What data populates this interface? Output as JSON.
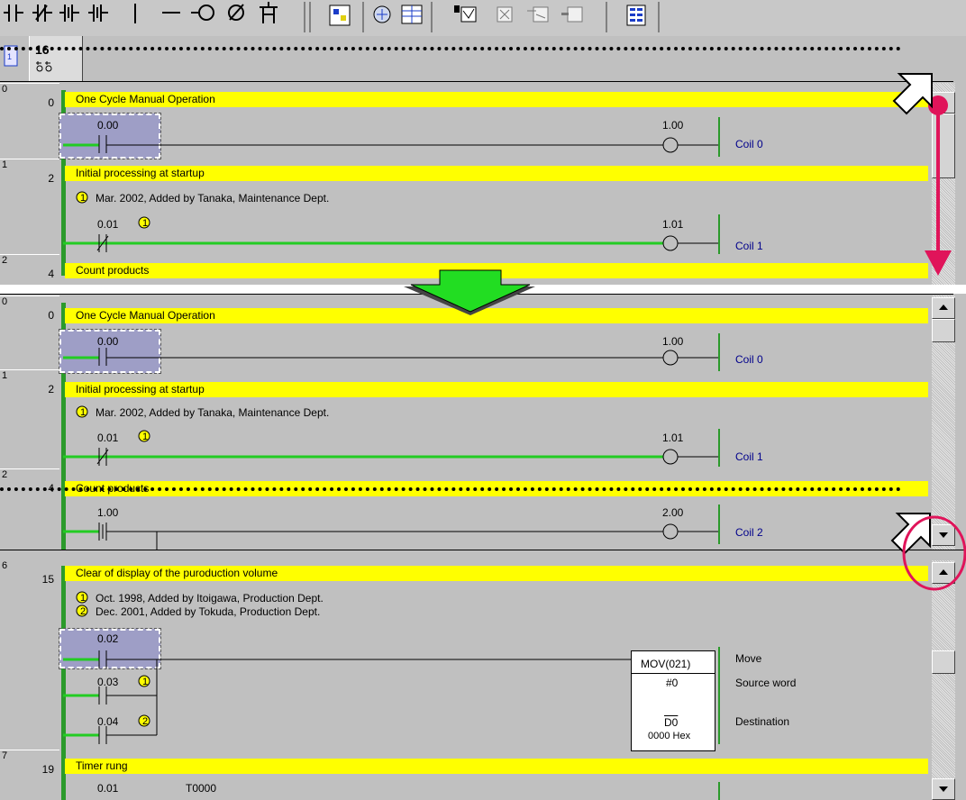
{
  "toolbar": {
    "glyphs": [
      "┫┣",
      "┫/┣",
      "┫↑┣",
      "┫↓┣",
      "┃",
      "─",
      "-○",
      "∅",
      "⌶"
    ],
    "view_tab_label": "16",
    "icon_names": [
      "contact-no-icon",
      "contact-nc-icon",
      "contact-up-icon",
      "contact-down-icon",
      "vertical-line-icon",
      "horizontal-line-icon",
      "coil-icon",
      "coil-nc-icon",
      "instruction-icon",
      "program-icon",
      "watch-icon",
      "table-icon",
      "edit-icon",
      "delete-icon",
      "insert-icon",
      "window-icon",
      "grid-icon"
    ]
  },
  "panes": {
    "pane1": {
      "rungs": [
        {
          "index": "0",
          "step": "0",
          "comment": "One Cycle Manual Operation",
          "contact_addr": "0.00",
          "coil_addr": "1.00",
          "coil_name": "Coil 0"
        },
        {
          "index": "1",
          "step": "2",
          "comment": "Initial processing at startup",
          "note_marker": "1",
          "note": "Mar. 2002, Added by Tanaka, Maintenance Dept.",
          "contact_addr": "0.01",
          "contact_marker": "1",
          "coil_addr": "1.01",
          "coil_name": "Coil 1"
        },
        {
          "index": "2",
          "step": "4",
          "comment": "Count products"
        }
      ]
    },
    "pane2": {
      "rungs": [
        {
          "index": "0",
          "step": "0",
          "comment": "One Cycle Manual Operation",
          "contact_addr": "0.00",
          "coil_addr": "1.00",
          "coil_name": "Coil 0"
        },
        {
          "index": "1",
          "step": "2",
          "comment": "Initial processing at startup",
          "note_marker": "1",
          "note": "Mar. 2002, Added by Tanaka, Maintenance Dept.",
          "contact_addr": "0.01",
          "contact_marker": "1",
          "coil_addr": "1.01",
          "coil_name": "Coil 1"
        },
        {
          "index": "2",
          "step": "4",
          "comment": "Count products",
          "contact_addr": "1.00",
          "coil_addr": "2.00",
          "coil_name": "Coil 2"
        }
      ]
    },
    "pane3": {
      "rungs": [
        {
          "index": "6",
          "step": "15",
          "comment": "Clear of display of the puroduction volume",
          "notes": [
            {
              "marker": "1",
              "text": "Oct. 1998, Added by Itoigawa, Production Dept."
            },
            {
              "marker": "2",
              "text": "Dec. 2001, Added by Tokuda, Production Dept."
            }
          ],
          "contacts": [
            {
              "addr": "0.02"
            },
            {
              "addr": "0.03",
              "marker": "1"
            },
            {
              "addr": "0.04",
              "marker": "2"
            }
          ],
          "instruction": {
            "name": "MOV(021)",
            "operand1": "#0",
            "operand2": "D0",
            "operand2_value": "0000 Hex"
          },
          "operand_comments": [
            "Move",
            "Source word",
            "Destination"
          ]
        },
        {
          "index": "7",
          "step": "19",
          "comment": "Timer rung",
          "contact_addr": "0.01",
          "timer": "T0000"
        }
      ]
    }
  },
  "colors": {
    "comment_bar": "#ffff00",
    "power_rail": "#2b9a2b",
    "arrow_down": "#e0145a",
    "transition_arrow": "#22dd22"
  }
}
